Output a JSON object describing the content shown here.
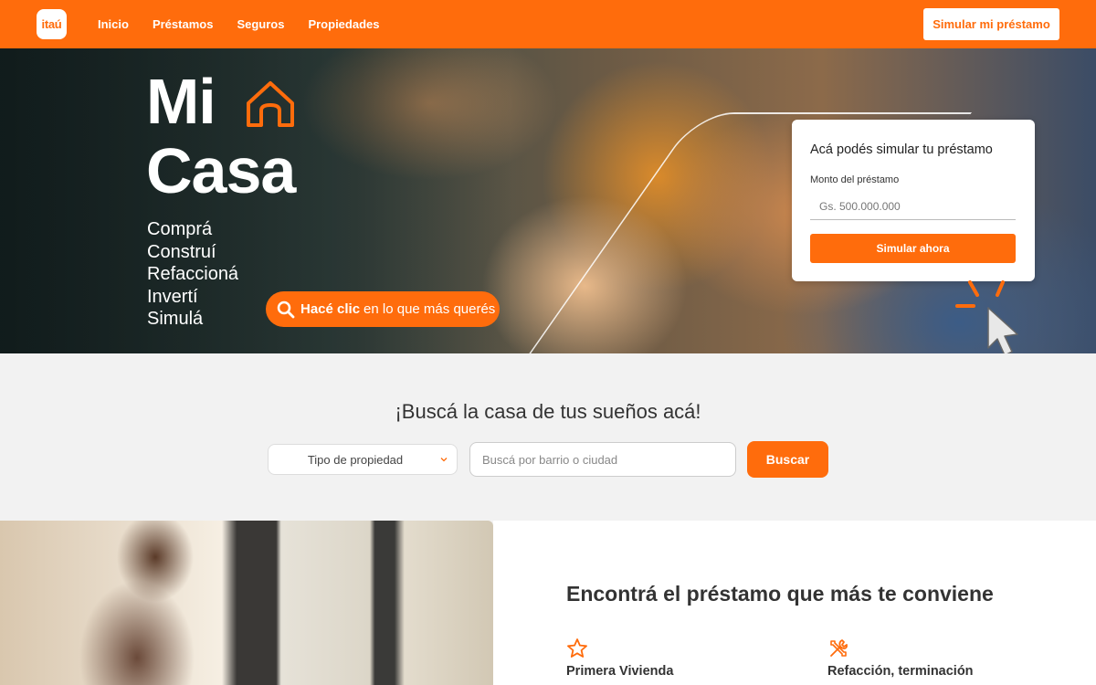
{
  "nav": {
    "logo_text": "itaú",
    "links": [
      "Inicio",
      "Préstamos",
      "Seguros",
      "Propiedades"
    ],
    "cta": "Simular mi préstamo"
  },
  "hero": {
    "title_line1": "Mi",
    "title_line2": "Casa",
    "actions": [
      "Comprá",
      "Construí",
      "Refaccioná",
      "Invertí",
      "Simulá"
    ],
    "pill_bold": "Hacé clic",
    "pill_rest": "en lo que más querés"
  },
  "simulator": {
    "title": "Acá podés simular tu préstamo",
    "amount_label": "Monto del préstamo",
    "amount_placeholder": "Gs. 500.000.000",
    "button": "Simular ahora"
  },
  "search": {
    "title": "¡Buscá la casa de tus sueños acá!",
    "type_select": "Tipo de propiedad",
    "location_placeholder": "Buscá por barrio o ciudad",
    "button": "Buscar"
  },
  "loans": {
    "title": "Encontrá el préstamo que más te conviene",
    "features": [
      {
        "label": "Primera Vivienda",
        "icon": "star-icon"
      },
      {
        "label": "Refacción, terminación",
        "icon": "tools-icon"
      }
    ]
  },
  "colors": {
    "brand_orange": "#ff6c0c"
  }
}
